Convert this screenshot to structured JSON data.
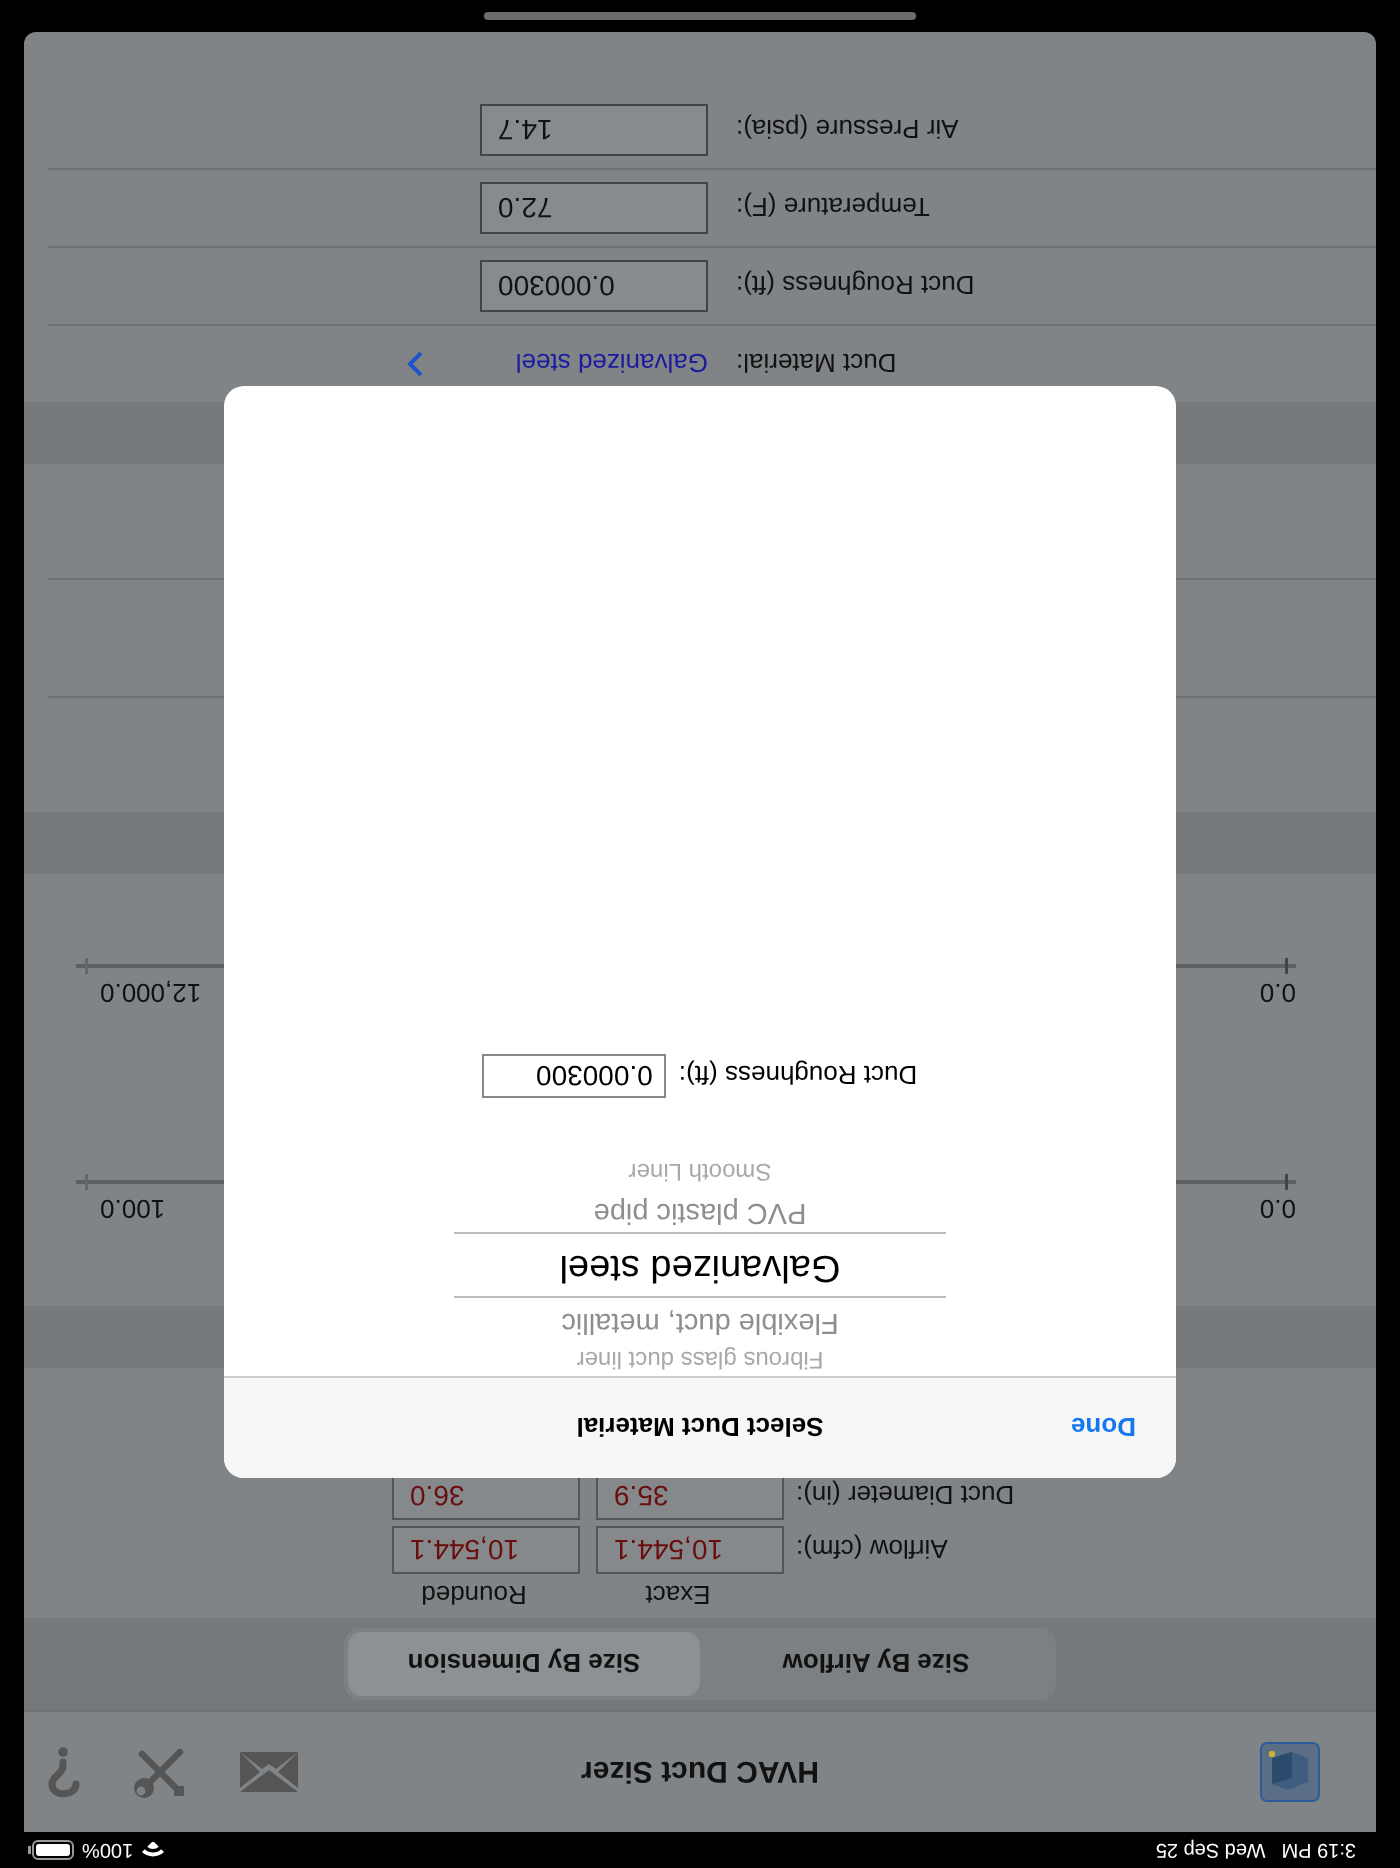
{
  "status_bar": {
    "time": "3:19 PM",
    "date": "Wed Sep 25",
    "battery": "100%"
  },
  "nav_bar": {
    "title": "HVAC Duct Sizer"
  },
  "tabs": [
    {
      "label": "Size By Airflow",
      "selected": false
    },
    {
      "label": "Size By Dimension",
      "selected": true
    }
  ],
  "results": {
    "columns": [
      "Exact",
      "Rounded"
    ],
    "rows": [
      {
        "label": "Airflow (cfm):",
        "exact": "10,544.1",
        "rounded": "10,544.1"
      },
      {
        "label": "Duct Diameter (in):",
        "exact": "35.9",
        "rounded": "36.0"
      }
    ]
  },
  "sliders": [
    {
      "min_label": "0.0",
      "max_label": "100.0"
    },
    {
      "min_label": "0.0",
      "max_label": "12,000.0"
    }
  ],
  "settings": [
    {
      "kind": "link",
      "label": "Duct Material:",
      "value": "Galvanized steel"
    },
    {
      "kind": "field",
      "label": "Duct Roughness (ft):",
      "value": "0.000300"
    },
    {
      "kind": "field",
      "label": "Temperature (F):",
      "value": "72.0"
    },
    {
      "kind": "field",
      "label": "Air Pressure (psia):",
      "value": "14.7"
    }
  ],
  "modal": {
    "title": "Select Duct Material",
    "done": "Done",
    "picker": [
      {
        "label": "Fibrous glass duct liner",
        "selected": false
      },
      {
        "label": "Flexible duct, metallic",
        "selected": false
      },
      {
        "label": "Galvanized steel",
        "selected": true
      },
      {
        "label": "PVC plastic pipe",
        "selected": false
      },
      {
        "label": "Smooth Liner",
        "selected": false
      }
    ],
    "field": {
      "label": "Duct Roughness (ft):",
      "value": "0.000300"
    }
  }
}
